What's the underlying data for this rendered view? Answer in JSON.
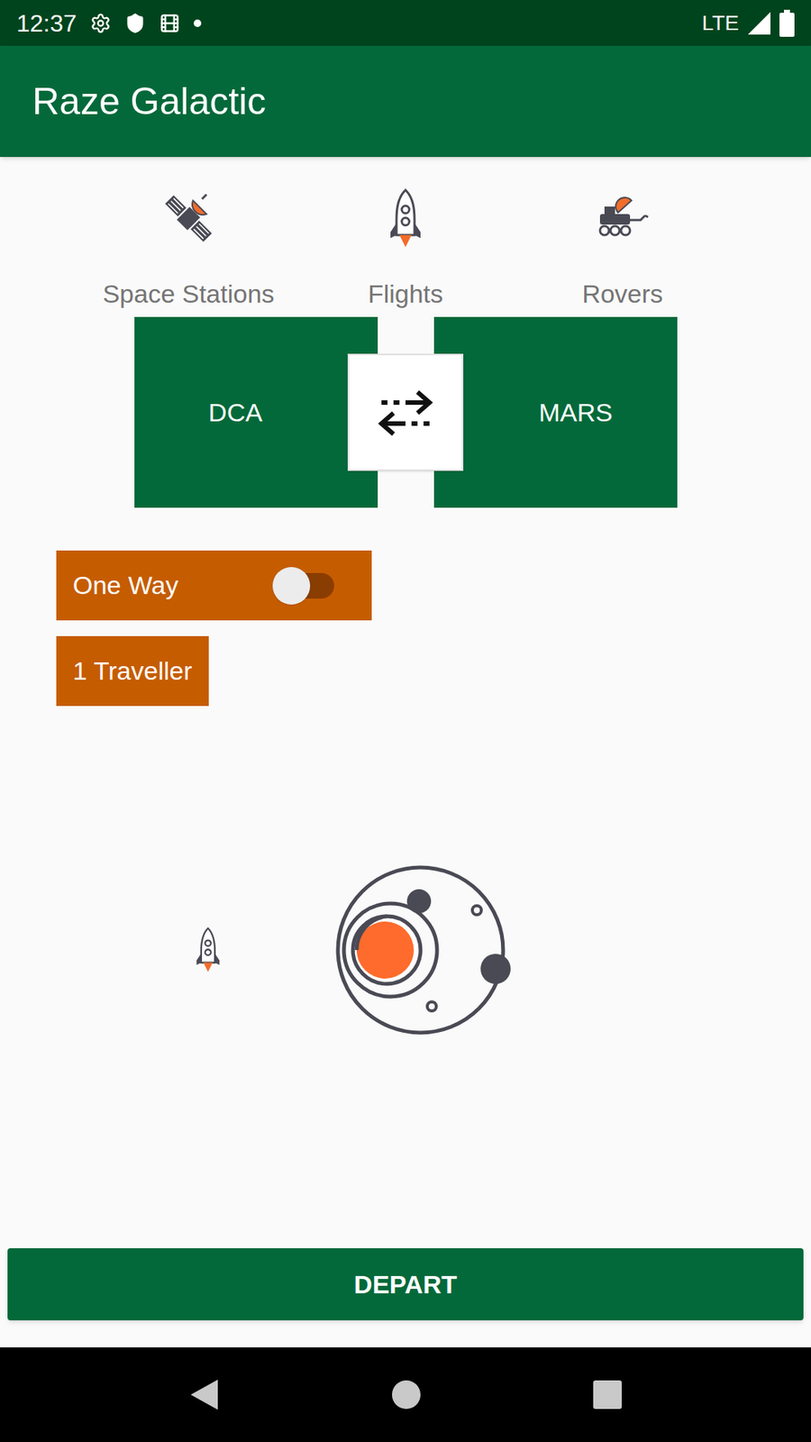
{
  "status_bar": {
    "time": "12:37",
    "network": "LTE"
  },
  "app_bar": {
    "title": "Raze Galactic"
  },
  "categories": [
    {
      "label": "Space Stations",
      "kind": "satellite"
    },
    {
      "label": "Flights",
      "kind": "rocket"
    },
    {
      "label": "Rovers",
      "kind": "rover"
    }
  ],
  "route": {
    "from": "DCA",
    "to": "MARS"
  },
  "trip_toggle": {
    "label": "One Way",
    "on": false
  },
  "travellers": "1 Traveller",
  "depart_button": "DEPART"
}
